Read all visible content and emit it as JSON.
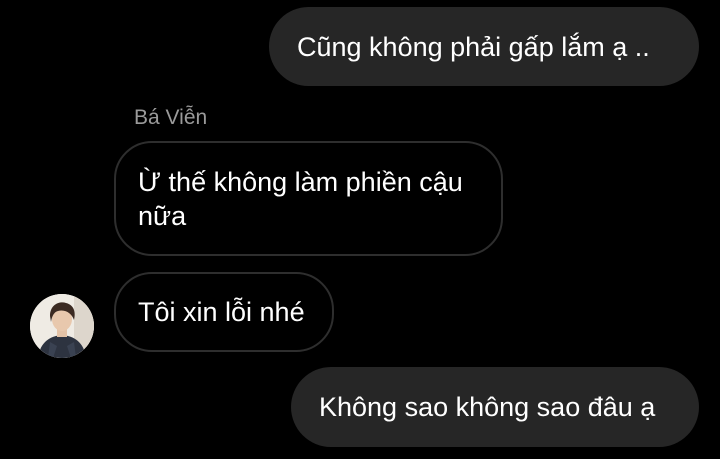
{
  "colors": {
    "background": "#000000",
    "outgoing_bubble": "#262626",
    "incoming_border": "#2e2e2e",
    "sender_name": "#9a9a9a",
    "text": "#ffffff"
  },
  "messages": [
    {
      "direction": "outgoing",
      "text": "Cũng không phải gấp lắm ạ .."
    },
    {
      "direction": "incoming",
      "sender": "Bá Viễn",
      "text": "Ừ thế không làm phiền cậu nữa"
    },
    {
      "direction": "incoming",
      "text": "Tôi xin lỗi nhé",
      "avatar_icon": "user-avatar"
    },
    {
      "direction": "outgoing",
      "text": "Không sao không sao đâu ạ"
    }
  ]
}
